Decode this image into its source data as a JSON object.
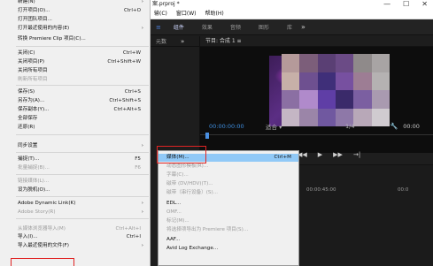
{
  "app": {
    "title_fragment": "案.prproj *",
    "window_controls": [
      "—",
      "☐",
      "✕"
    ],
    "menubar": [
      "输(C)",
      "窗口(W)",
      "帮助(H)"
    ],
    "workspaces": {
      "home_icon": "≡",
      "items": [
        "组件",
        "效果",
        "音频",
        "图形",
        "库"
      ],
      "more": "»"
    },
    "source_panel": {
      "tab": "元数",
      "more": "»"
    },
    "program_panel": {
      "tab": "节目: 合成 1 ≡",
      "timecode": "00:00:00:00",
      "fit": "适合 ▾",
      "fraction": "1/4",
      "wrench_icon": "🔧",
      "end_time": "00:00"
    },
    "transport": [
      "◀◀",
      "▶",
      "▶▶",
      "→|"
    ],
    "timeline": {
      "time1": "00:00:45:00",
      "time2": "00:0"
    }
  },
  "file_menu": {
    "items": [
      {
        "label": "新建(N)",
        "shortcut": "",
        "arrow": "›",
        "disabled": false
      },
      {
        "label": "打开项目(O)...",
        "shortcut": "Ctrl+O",
        "arrow": "",
        "disabled": false
      },
      {
        "label": "打开团队项目...",
        "shortcut": "",
        "arrow": "",
        "disabled": false
      },
      {
        "label": "打开最近使用的内容(E)",
        "shortcut": "",
        "arrow": "›",
        "disabled": false
      },
      {
        "label": "转换 Premiere Clip 项目(C)...",
        "shortcut": "",
        "arrow": "",
        "disabled": false
      },
      {
        "label": "关闭(C)",
        "shortcut": "Ctrl+W",
        "arrow": "",
        "disabled": false
      },
      {
        "label": "关闭项目(P)",
        "shortcut": "Ctrl+Shift+W",
        "arrow": "",
        "disabled": false
      },
      {
        "label": "关闭所有项目",
        "shortcut": "",
        "arrow": "",
        "disabled": false
      },
      {
        "label": "刷新所有项目",
        "shortcut": "",
        "arrow": "",
        "disabled": true
      },
      {
        "label": "保存(S)",
        "shortcut": "Ctrl+S",
        "arrow": "",
        "disabled": false
      },
      {
        "label": "另存为(A)...",
        "shortcut": "Ctrl+Shift+S",
        "arrow": "",
        "disabled": false
      },
      {
        "label": "保存副本(Y)...",
        "shortcut": "Ctrl+Alt+S",
        "arrow": "",
        "disabled": false
      },
      {
        "label": "全部保存",
        "shortcut": "",
        "arrow": "",
        "disabled": false
      },
      {
        "label": "还原(R)",
        "shortcut": "",
        "arrow": "",
        "disabled": false
      },
      {
        "label": "同步设置",
        "shortcut": "",
        "arrow": "›",
        "disabled": false
      },
      {
        "label": "捕捉(T)...",
        "shortcut": "F5",
        "arrow": "",
        "disabled": false
      },
      {
        "label": "批量捕捉(B)...",
        "shortcut": "F6",
        "arrow": "",
        "disabled": true
      },
      {
        "label": "链接媒体(L)...",
        "shortcut": "",
        "arrow": "",
        "disabled": true
      },
      {
        "label": "设为脱机(O)...",
        "shortcut": "",
        "arrow": "",
        "disabled": false
      },
      {
        "label": "Adobe Dynamic Link(K)",
        "shortcut": "",
        "arrow": "›",
        "disabled": false
      },
      {
        "label": "Adobe Story(R)",
        "shortcut": "",
        "arrow": "›",
        "disabled": true
      },
      {
        "label": "从媒体浏览器导入(M)",
        "shortcut": "Ctrl+Alt+I",
        "arrow": "",
        "disabled": true
      },
      {
        "label": "导入(I)...",
        "shortcut": "Ctrl+I",
        "arrow": "",
        "disabled": false
      },
      {
        "label": "导入最近使用的文件(F)",
        "shortcut": "",
        "arrow": "›",
        "disabled": false
      }
    ]
  },
  "export_menu": {
    "items": [
      {
        "label": "媒体(M)...",
        "shortcut": "Ctrl+M",
        "disabled": false,
        "selected": true
      },
      {
        "label": "动态图形模板(R)...",
        "shortcut": "",
        "disabled": true,
        "selected": false
      },
      {
        "label": "字幕(C)...",
        "shortcut": "",
        "disabled": true,
        "selected": false
      },
      {
        "label": "磁带 (DV/HDV)(T)...",
        "shortcut": "",
        "disabled": true,
        "selected": false
      },
      {
        "label": "磁带（串行设备）(S)...",
        "shortcut": "",
        "disabled": true,
        "selected": false
      },
      {
        "label": "EDL...",
        "shortcut": "",
        "disabled": false,
        "selected": false
      },
      {
        "label": "OMF...",
        "shortcut": "",
        "disabled": true,
        "selected": false
      },
      {
        "label": "标记(M)...",
        "shortcut": "",
        "disabled": true,
        "selected": false
      },
      {
        "label": "将选择项导出为 Premiere 项目(S)...",
        "shortcut": "",
        "disabled": true,
        "selected": false
      },
      {
        "label": "AAF...",
        "shortcut": "",
        "disabled": false,
        "selected": false
      },
      {
        "label": "Avid Log Exchange...",
        "shortcut": "",
        "disabled": false,
        "selected": false
      }
    ]
  },
  "mosaic_colors": [
    "#b59a9a",
    "#7c5e7a",
    "#5a3f74",
    "#6b4b86",
    "#8f8a8a",
    "#a8a4a4",
    "#c7b0a8",
    "#6e5090",
    "#3f2f79",
    "#7750a0",
    "#9d7d94",
    "#b5b2b2",
    "#8b6fa3",
    "#b08acb",
    "#5f3ea6",
    "#3a2a6a",
    "#7b5fa1",
    "#a99ab0",
    "#c4b6c4",
    "#9b85a8",
    "#7058a0",
    "#8e78a8",
    "#b8a8b8",
    "#d0cbd0"
  ],
  "highlight_color": "#e02424"
}
